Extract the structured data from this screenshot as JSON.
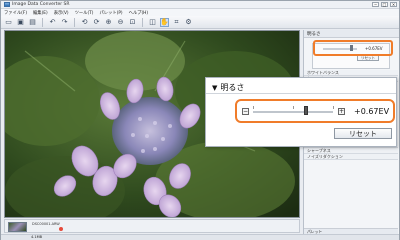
{
  "window": {
    "title": "Image Data Converter SR"
  },
  "menu": [
    "ファイル(F)",
    "編集(E)",
    "表示(V)",
    "ツール(T)",
    "パレット(P)",
    "ヘルプ(H)"
  ],
  "toolbar_icons": [
    "folder-open-icon",
    "save-icon",
    "print-icon",
    "undo-icon",
    "redo-icon",
    "rotate-left-icon",
    "rotate-right-icon",
    "zoom-in-icon",
    "zoom-out-icon",
    "fit-icon",
    "compare-icon",
    "hand-tool-icon",
    "crop-icon",
    "settings-icon"
  ],
  "right_panel": {
    "header": "明るさ",
    "mini_value": "+0.67EV",
    "mini_reset": "リセット",
    "sections_top": [
      "ホワイトバランス",
      "カラーバランス"
    ],
    "sections_bottom": [
      "トーンカーブ",
      "シャープネス",
      "ノイズリダクション"
    ],
    "footer": "パレット"
  },
  "brightness_popup": {
    "title": "明るさ",
    "minus": "−",
    "plus": "+",
    "value": "+0.67EV",
    "value_fraction": 0.67,
    "reset_label": "リセット"
  },
  "filmstrip": {
    "file_label": "DSC00001.ARW"
  },
  "status": {
    "text": "4.1MB"
  },
  "colors": {
    "highlight": "#f07c2a"
  }
}
